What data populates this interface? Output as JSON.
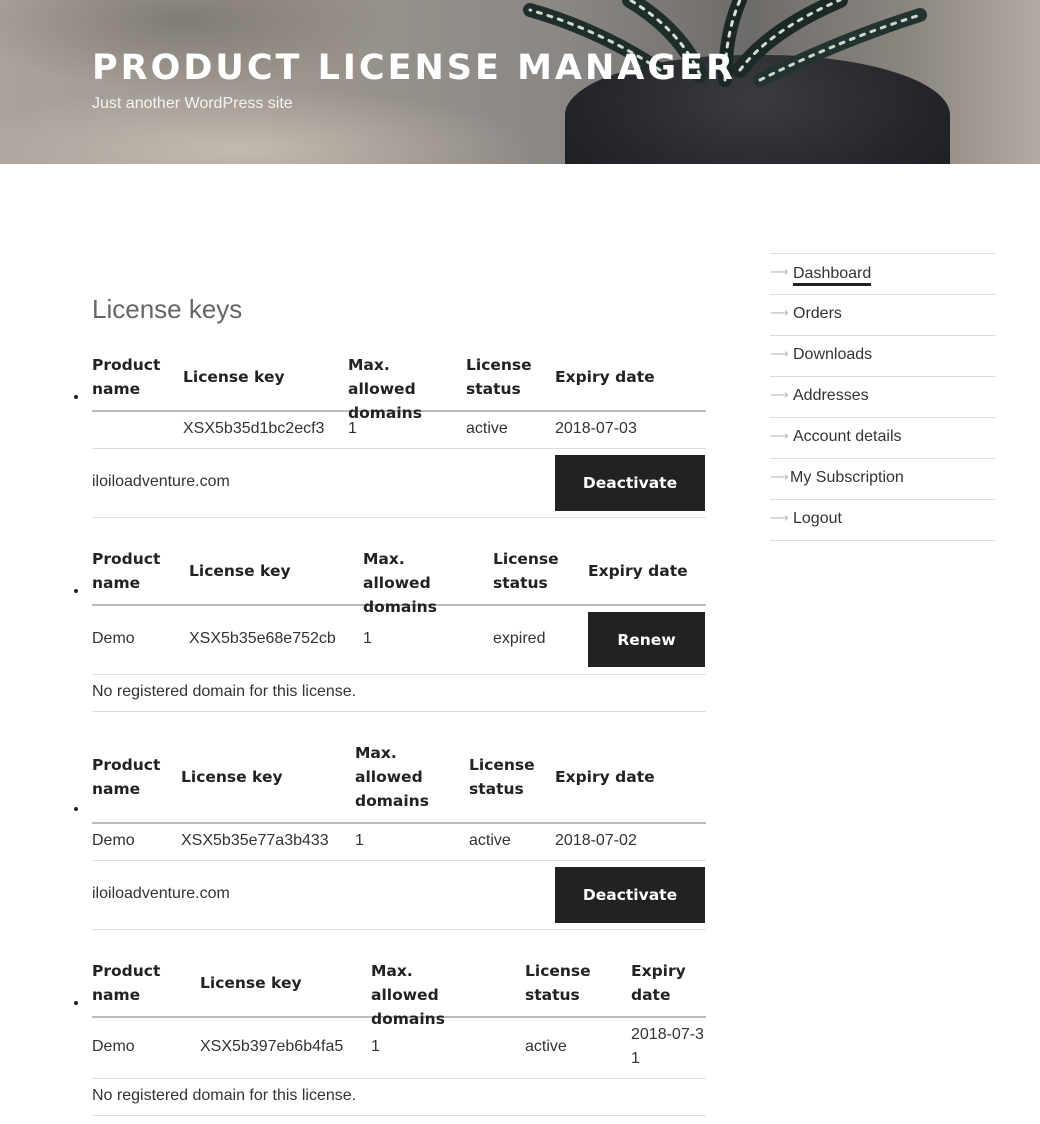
{
  "header": {
    "site_title": "PRODUCT LICENSE MANAGER",
    "tagline": "Just another WordPress site"
  },
  "main": {
    "page_title": "License keys",
    "licenses": [
      {
        "headers": {
          "product": "Product name",
          "key": "License key",
          "domains": "Max. allowed domains",
          "status": "License status",
          "expiry": "Expiry date"
        },
        "product": "",
        "key": "XSX5b35d1bc2ecf3",
        "max_domains": "1",
        "status": "active",
        "expiry": "2018-07-03",
        "domain": "iloiloadventure.com",
        "action": "Deactivate"
      },
      {
        "headers": {
          "product": "Product name",
          "key": "License key",
          "domains": "Max. allowed domains",
          "status": "License status",
          "expiry": "Expiry date"
        },
        "product": "Demo",
        "key": "XSX5b35e68e752cb",
        "max_domains": "1",
        "status": "expired",
        "action": "Renew",
        "domain_note": "No registered domain for this license."
      },
      {
        "headers": {
          "product": "Product name",
          "key": "License key",
          "domains": "Max. allowed domains",
          "status": "License status",
          "expiry": "Expiry date"
        },
        "product": "Demo",
        "key": "XSX5b35e77a3b433",
        "max_domains": "1",
        "status": "active",
        "expiry": "2018-07-02",
        "domain": "iloiloadventure.com",
        "action": "Deactivate"
      },
      {
        "headers": {
          "product": "Product name",
          "key": "License key",
          "domains": "Max. allowed domains",
          "status": "License status",
          "expiry": "Expiry date"
        },
        "product": "Demo",
        "key": "XSX5b397eb6b4fa5",
        "max_domains": "1",
        "status": "active",
        "expiry": "2018-07-31",
        "domain_note": "No registered domain for this license."
      }
    ]
  },
  "sidebar": {
    "items": [
      {
        "label": "Dashboard",
        "icon": "arrow-right-icon",
        "current": true
      },
      {
        "label": "Orders",
        "icon": "arrow-right-icon"
      },
      {
        "label": "Downloads",
        "icon": "arrow-right-icon"
      },
      {
        "label": "Addresses",
        "icon": "arrow-right-icon"
      },
      {
        "label": "Account details",
        "icon": "arrow-right-icon"
      },
      {
        "label": "My Subscription",
        "icon": "arrow-right-icon"
      },
      {
        "label": "Logout",
        "icon": "arrow-right-icon"
      }
    ]
  },
  "colors": {
    "button_bg": "#222222",
    "text": "#333333",
    "page_title": "#666666",
    "rule": "#dddddd"
  }
}
